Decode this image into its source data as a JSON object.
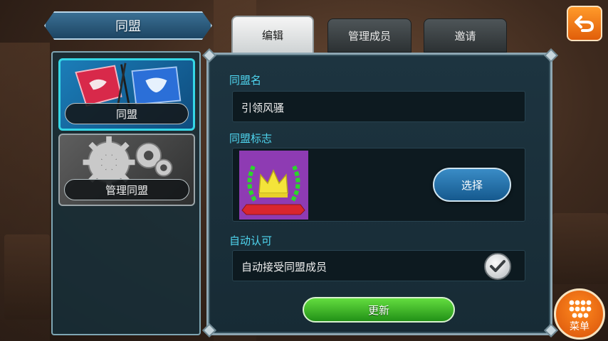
{
  "title": "同盟",
  "sidebar": {
    "items": [
      {
        "label": "同盟",
        "active": true
      },
      {
        "label": "管理同盟",
        "active": false
      }
    ]
  },
  "tabs": [
    {
      "label": "编辑",
      "active": true
    },
    {
      "label": "管理成员",
      "active": false
    },
    {
      "label": "邀请",
      "active": false
    }
  ],
  "form": {
    "name_label": "同盟名",
    "name_value": "引领风骚",
    "emblem_label": "同盟标志",
    "select_button": "选择",
    "auto_label": "自动认可",
    "auto_text": "自动接受同盟成员",
    "auto_checked": true,
    "update_button": "更新"
  },
  "menu_label": "菜单",
  "colors": {
    "accent_cyan": "#4fd6f0",
    "emblem_bg": "#8e3bb3",
    "update_green": "#229117",
    "back_orange": "#e15e0a"
  }
}
